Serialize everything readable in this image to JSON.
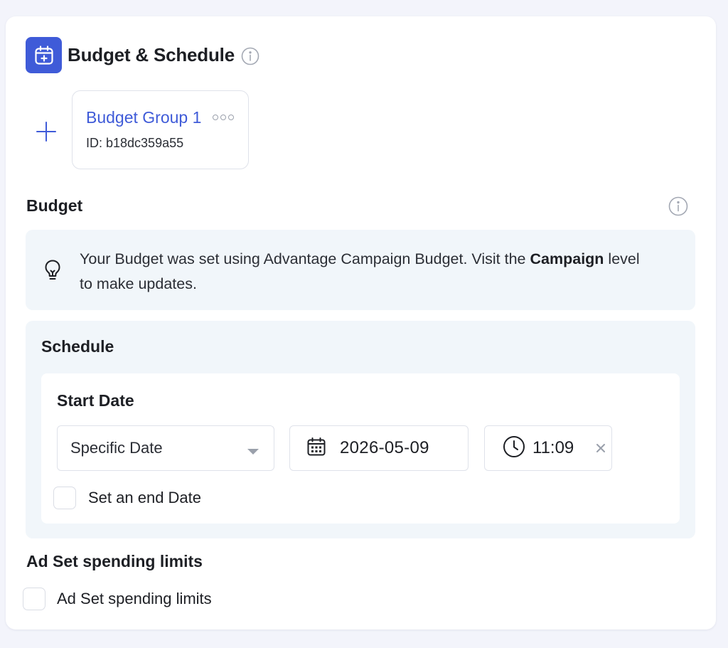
{
  "header": {
    "title": "Budget & Schedule",
    "icon": "calendar-add-icon",
    "accent_color": "#3f5bd8"
  },
  "budget_group": {
    "name": "Budget Group 1",
    "id_text": "ID: b18dc359a55"
  },
  "budget": {
    "title": "Budget",
    "notice_prefix": "Your Budget was set using Advantage Campaign Budget. Visit the",
    "notice_link": "Campaign",
    "notice_suffix": " level to make updates."
  },
  "schedule": {
    "title": "Schedule",
    "start_title": "Start Date",
    "date_mode": "Specific Date",
    "date": "2026-05-09",
    "time": "11:09",
    "end_date_label": "Set an end Date",
    "end_date_checked": false
  },
  "limits": {
    "title": "Ad Set spending limits",
    "checkbox_label": "Ad Set spending limits",
    "checked": false
  }
}
